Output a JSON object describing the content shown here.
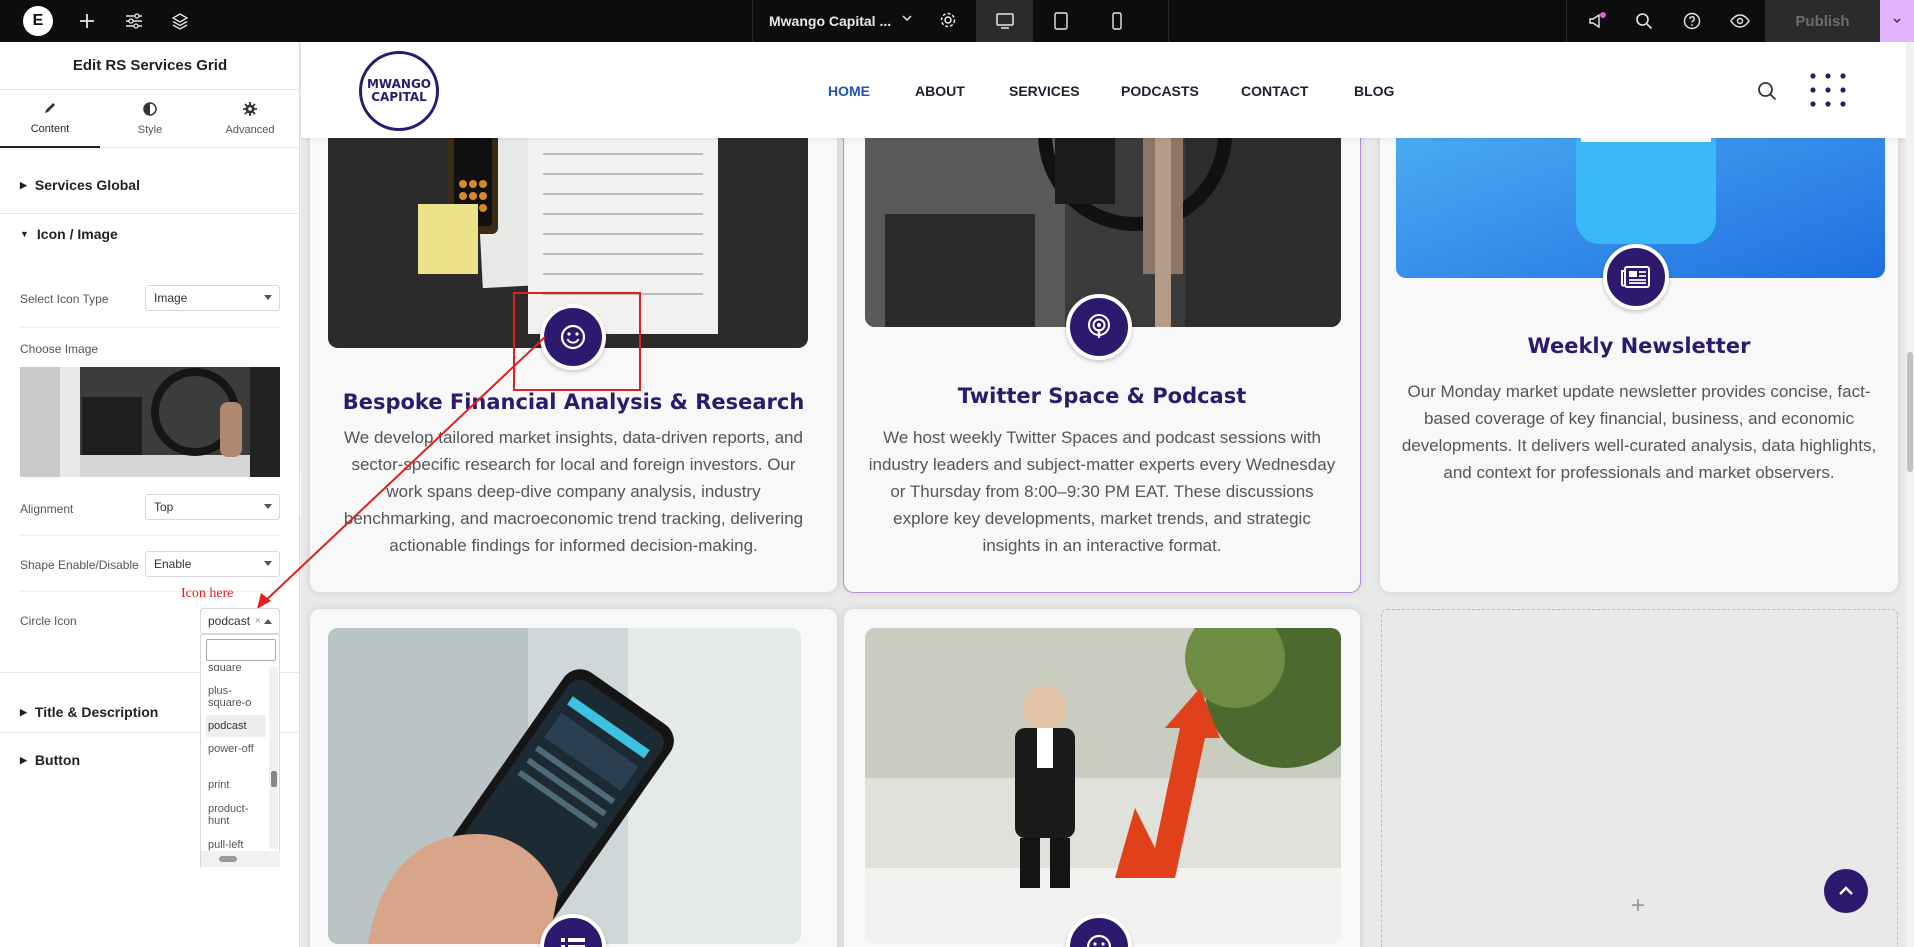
{
  "topbar": {
    "site_name": "Mwango Capital ...",
    "publish_label": "Publish"
  },
  "panel": {
    "title": "Edit RS Services Grid",
    "tabs": [
      {
        "label": "Content"
      },
      {
        "label": "Style"
      },
      {
        "label": "Advanced"
      }
    ],
    "sections": {
      "services_global": "Services Global",
      "icon_image": "Icon / Image",
      "title_description": "Title & Description",
      "button": "Button"
    },
    "controls": {
      "select_icon_type": {
        "label": "Select Icon Type",
        "value": "Image"
      },
      "choose_image": {
        "label": "Choose Image"
      },
      "alignment": {
        "label": "Alignment",
        "value": "Top"
      },
      "shape": {
        "label": "Shape Enable/Disable",
        "value": "Enable"
      },
      "circle_icon": {
        "label": "Circle Icon",
        "value": "podcast"
      }
    },
    "dropdown_options": [
      "square",
      "plus-square-o",
      "podcast",
      "power-off",
      "print",
      "product-hunt",
      "pull-left"
    ],
    "annotation": "Icon here"
  },
  "site": {
    "logo_line1": "MWANGO",
    "logo_line2": "CAPITAL",
    "nav": [
      "HOME",
      "ABOUT",
      "SERVICES",
      "PODCASTS",
      "CONTACT",
      "BLOG"
    ],
    "active_nav": "HOME"
  },
  "cards": [
    {
      "title": "Bespoke Financial Analysis & Research",
      "description": "We develop tailored market insights, data-driven reports, and sector-specific research for local and foreign investors. Our work spans deep-dive company analysis, industry benchmarking, and macroeconomic trend tracking, delivering actionable findings for informed decision-making.",
      "icon": "smile-icon"
    },
    {
      "title": "Twitter Space & Podcast",
      "description": "We host weekly Twitter Spaces and podcast sessions with industry leaders and subject-matter experts every Wednesday or Thursday from 8:00–9:30 PM EAT. These discussions explore key developments, market trends, and strategic insights in an interactive format.",
      "icon": "podcast-icon"
    },
    {
      "title": "Weekly Newsletter",
      "description": "Our Monday market update newsletter provides concise, fact-based coverage of key financial, business, and economic developments. It delivers well-curated analysis, data highlights, and context for professionals and market observers.",
      "icon": "newspaper-icon"
    }
  ],
  "colors": {
    "brand": "#2d1a6e",
    "active_nav": "#2452b0",
    "annotation": "#e02020",
    "editor_bar": "#0c0d0e",
    "publish_accent": "#e4b3ff"
  }
}
